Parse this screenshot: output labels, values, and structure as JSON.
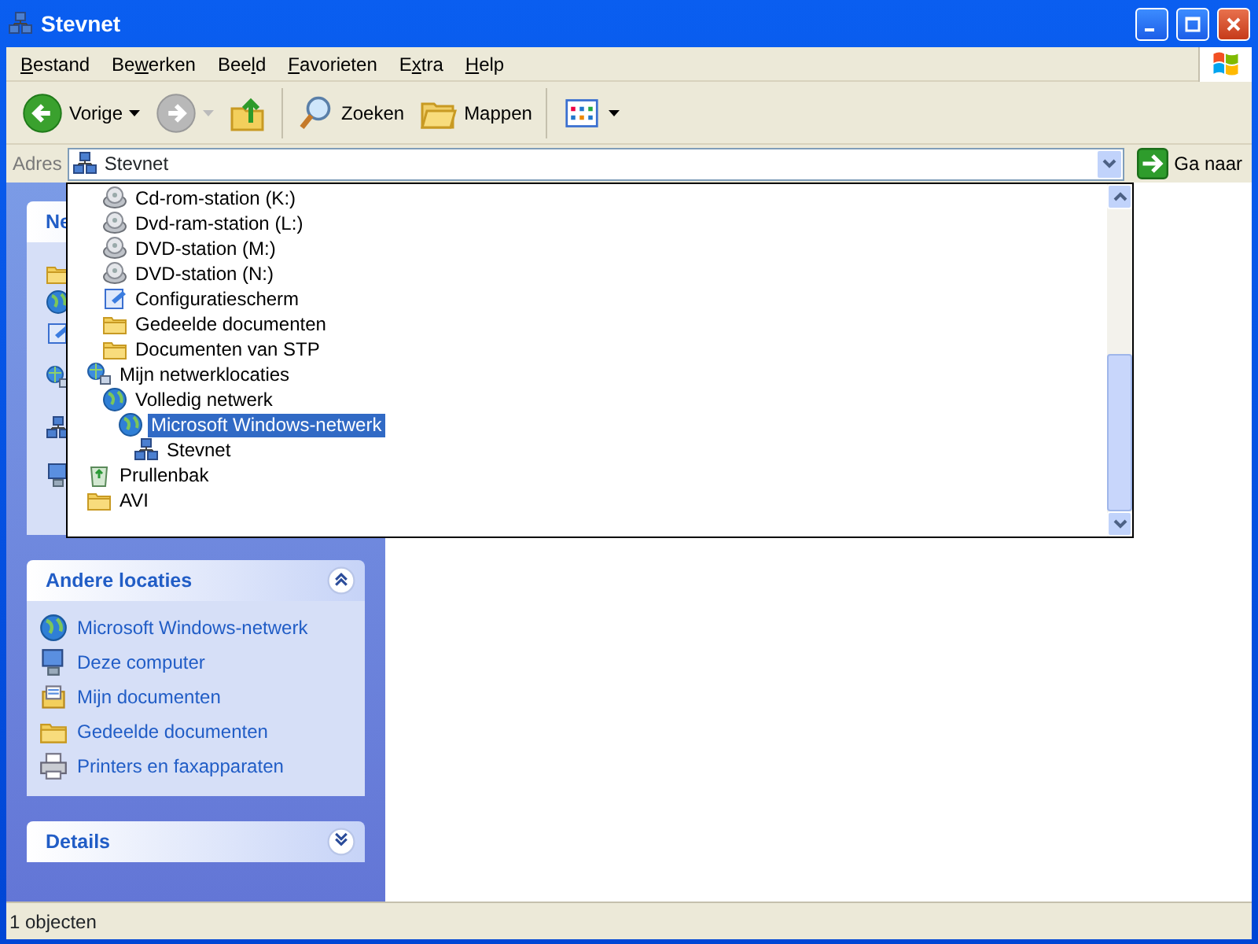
{
  "window": {
    "title": "Stevnet"
  },
  "menu": [
    {
      "access_key": "B",
      "after": "estand"
    },
    {
      "before": "Be",
      "access_key": "w",
      "after": "erken"
    },
    {
      "before": "Bee",
      "access_key": "l",
      "after": "d"
    },
    {
      "access_key": "F",
      "after": "avorieten"
    },
    {
      "before": "E",
      "access_key": "x",
      "after": "tra"
    },
    {
      "access_key": "H",
      "after": "elp"
    }
  ],
  "toolbar": [
    {
      "kind": "back",
      "label": "Vorige",
      "disabled": false
    },
    {
      "kind": "forward",
      "disabled": true
    },
    {
      "kind": "up",
      "disabled": false
    },
    {
      "kind": "search",
      "label": "Zoeken",
      "disabled": false
    },
    {
      "kind": "folders",
      "label": "Mappen",
      "disabled": false
    },
    {
      "kind": "views",
      "disabled": false
    }
  ],
  "address": {
    "label": "Adres",
    "value": "Stevnet",
    "go_label": "Ga naar"
  },
  "dropdown": {
    "tree": [
      {
        "children": [
          {
            "label": "Cd-rom-station (K:)",
            "kind": "drive",
            "selected": false
          },
          {
            "label": "Dvd-ram-station (L:)",
            "kind": "drive",
            "selected": false
          },
          {
            "label": "DVD-station (M:)",
            "kind": "drive",
            "selected": false
          },
          {
            "label": "DVD-station (N:)",
            "kind": "drive",
            "selected": false
          },
          {
            "label": "Configuratiescherm",
            "kind": "control-panel",
            "selected": false
          },
          {
            "label": "Gedeelde documenten",
            "kind": "folder",
            "selected": false
          },
          {
            "label": "Documenten van STP",
            "kind": "folder",
            "selected": false
          }
        ]
      },
      {
        "label": "Mijn netwerklocaties",
        "kind": "network",
        "selected": false,
        "children": [
          {
            "label": "Volledig netwerk",
            "kind": "globe",
            "selected": false,
            "children": [
              {
                "label": "Microsoft Windows-netwerk",
                "kind": "globe",
                "selected": true,
                "children": [
                  {
                    "label": "Stevnet",
                    "kind": "computers",
                    "selected": false
                  }
                ]
              }
            ]
          }
        ]
      },
      {
        "label": "Prullenbak",
        "kind": "recycle-bin",
        "selected": false
      },
      {
        "label": "AVI",
        "kind": "folder",
        "selected": false
      }
    ]
  },
  "task_panels": [
    {
      "title": "Ne",
      "expanded": true
    },
    {
      "title": "Andere locaties",
      "expanded": true,
      "items": [
        {
          "label": "Microsoft Windows-netwerk",
          "kind": "globe"
        },
        {
          "label": "Deze computer",
          "kind": "computer"
        },
        {
          "label": "Mijn documenten",
          "kind": "documents"
        },
        {
          "label": "Gedeelde documenten",
          "kind": "folder"
        },
        {
          "label": "Printers en faxapparaten",
          "kind": "printer"
        }
      ]
    },
    {
      "title": "Details",
      "expanded": false
    }
  ],
  "status_bar": {
    "text": "1 objecten"
  }
}
